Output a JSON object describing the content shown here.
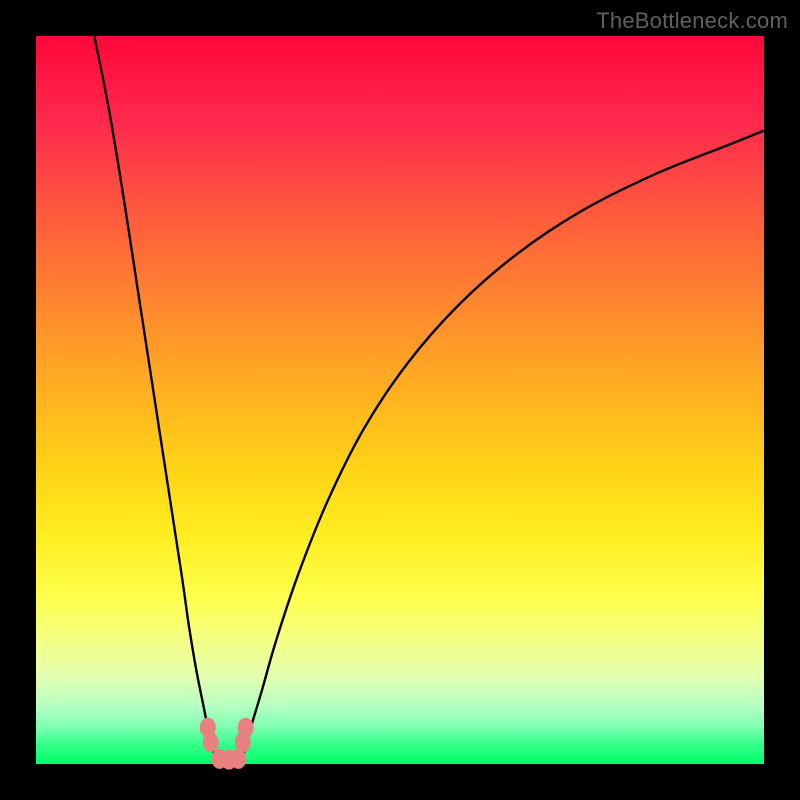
{
  "watermark": "TheBottleneck.com",
  "chart_data": {
    "type": "line",
    "title": "",
    "xlabel": "",
    "ylabel": "",
    "xlim": [
      0,
      100
    ],
    "ylim": [
      0,
      100
    ],
    "grid": false,
    "legend": false,
    "series": [
      {
        "name": "left-branch",
        "x": [
          8,
          10,
          12,
          14,
          16,
          18,
          20,
          21,
          22,
          23,
          23.8,
          24.3,
          24.8
        ],
        "y": [
          100,
          90,
          78,
          65,
          52,
          39,
          26,
          19,
          13,
          8,
          4,
          2,
          0.5
        ]
      },
      {
        "name": "right-branch",
        "x": [
          28.2,
          28.7,
          29.5,
          31,
          33,
          36,
          40,
          45,
          51,
          58,
          66,
          75,
          85,
          95,
          100
        ],
        "y": [
          0.5,
          2,
          5,
          10,
          17,
          26,
          36,
          46,
          55,
          63,
          70,
          76,
          81,
          85,
          87
        ]
      }
    ],
    "flat_segment": {
      "x": [
        24.8,
        28.2
      ],
      "y": [
        0.5,
        0.5
      ]
    },
    "markers": [
      {
        "name": "left-cluster-upper",
        "cx": 23.6,
        "cy": 5.0
      },
      {
        "name": "left-cluster-lower",
        "cx": 24.0,
        "cy": 3.0
      },
      {
        "name": "right-cluster-upper",
        "cx": 28.8,
        "cy": 5.0
      },
      {
        "name": "right-cluster-lower",
        "cx": 28.4,
        "cy": 3.0
      },
      {
        "name": "bottom-left",
        "cx": 25.2,
        "cy": 0.7
      },
      {
        "name": "bottom-mid",
        "cx": 26.5,
        "cy": 0.6
      },
      {
        "name": "bottom-right",
        "cx": 27.8,
        "cy": 0.7
      }
    ]
  }
}
